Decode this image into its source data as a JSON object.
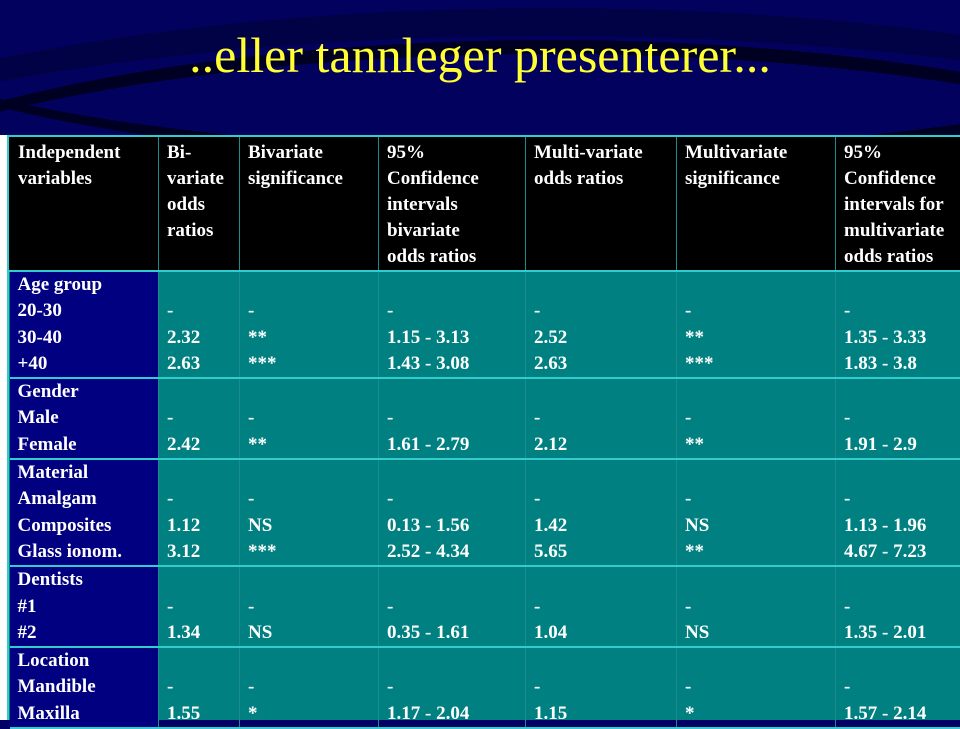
{
  "slide": {
    "title": "..eller tannleger presenterer...",
    "colors": {
      "background": "#000066",
      "title_text": "#ffff33",
      "table_body": "#008080",
      "label_column": "#000080",
      "header_row": "#000000",
      "rule": "#33cccc",
      "cell_text": "#ffffff"
    }
  },
  "table": {
    "headers": [
      [
        "Independent",
        "variables"
      ],
      [
        "Bi-",
        "variate",
        "odds",
        "ratios"
      ],
      [
        "Bivariate",
        "significance"
      ],
      [
        "95%",
        "Confidence",
        "intervals",
        "bivariate",
        "odds ratios"
      ],
      [
        "Multi-variate",
        "odds ratios"
      ],
      [
        "Multivariate",
        "significance"
      ],
      [
        "95%",
        "Confidence",
        "intervals for",
        "multivariate",
        "odds ratios"
      ]
    ],
    "groups": [
      {
        "variable": [
          "Age group",
          "20-30",
          "30-40",
          "+40"
        ],
        "biv_or": [
          "",
          "-",
          "2.32",
          "2.63"
        ],
        "biv_sig": [
          "",
          "-",
          "**",
          "***"
        ],
        "biv_ci": [
          "",
          "-",
          "1.15 - 3.13",
          "1.43 - 3.08"
        ],
        "multi_or": [
          "",
          "-",
          "2.52",
          "2.63"
        ],
        "multi_sig": [
          "",
          "-",
          "**",
          "***"
        ],
        "multi_ci": [
          "",
          "-",
          "1.35 - 3.33",
          "1.83 - 3.8"
        ]
      },
      {
        "variable": [
          "Gender",
          "Male",
          "Female"
        ],
        "biv_or": [
          "",
          "-",
          "2.42"
        ],
        "biv_sig": [
          "",
          "-",
          "**"
        ],
        "biv_ci": [
          "",
          "-",
          "1.61 - 2.79"
        ],
        "multi_or": [
          "",
          "-",
          "2.12"
        ],
        "multi_sig": [
          "",
          "-",
          "**"
        ],
        "multi_ci": [
          "",
          "-",
          "1.91 - 2.9"
        ]
      },
      {
        "variable": [
          "Material",
          "Amalgam",
          "Composites",
          "Glass ionom."
        ],
        "biv_or": [
          "",
          "-",
          "1.12",
          "3.12"
        ],
        "biv_sig": [
          "",
          "-",
          "NS",
          "***"
        ],
        "biv_ci": [
          "",
          "-",
          "0.13 - 1.56",
          "2.52 - 4.34"
        ],
        "multi_or": [
          "",
          "-",
          "1.42",
          "5.65"
        ],
        "multi_sig": [
          "",
          "-",
          "NS",
          "**"
        ],
        "multi_ci": [
          "",
          "-",
          "1.13 - 1.96",
          "4.67 - 7.23"
        ]
      },
      {
        "variable": [
          "Dentists",
          "#1",
          "#2"
        ],
        "biv_or": [
          "",
          "-",
          "1.34"
        ],
        "biv_sig": [
          "",
          "-",
          "NS"
        ],
        "biv_ci": [
          "",
          "-",
          "0.35 - 1.61"
        ],
        "multi_or": [
          "",
          "-",
          "1.04"
        ],
        "multi_sig": [
          "",
          "-",
          "NS"
        ],
        "multi_ci": [
          "",
          "-",
          "1.35 - 2.01"
        ]
      },
      {
        "variable": [
          "Location",
          "Mandible",
          "Maxilla"
        ],
        "biv_or": [
          "",
          "-",
          "1.55"
        ],
        "biv_sig": [
          "",
          "-",
          "*"
        ],
        "biv_ci": [
          "",
          "-",
          "1.17 - 2.04"
        ],
        "multi_or": [
          "",
          "-",
          "1.15"
        ],
        "multi_sig": [
          "",
          "-",
          "*"
        ],
        "multi_ci": [
          "",
          "-",
          "1.57 - 2.14"
        ]
      }
    ]
  }
}
